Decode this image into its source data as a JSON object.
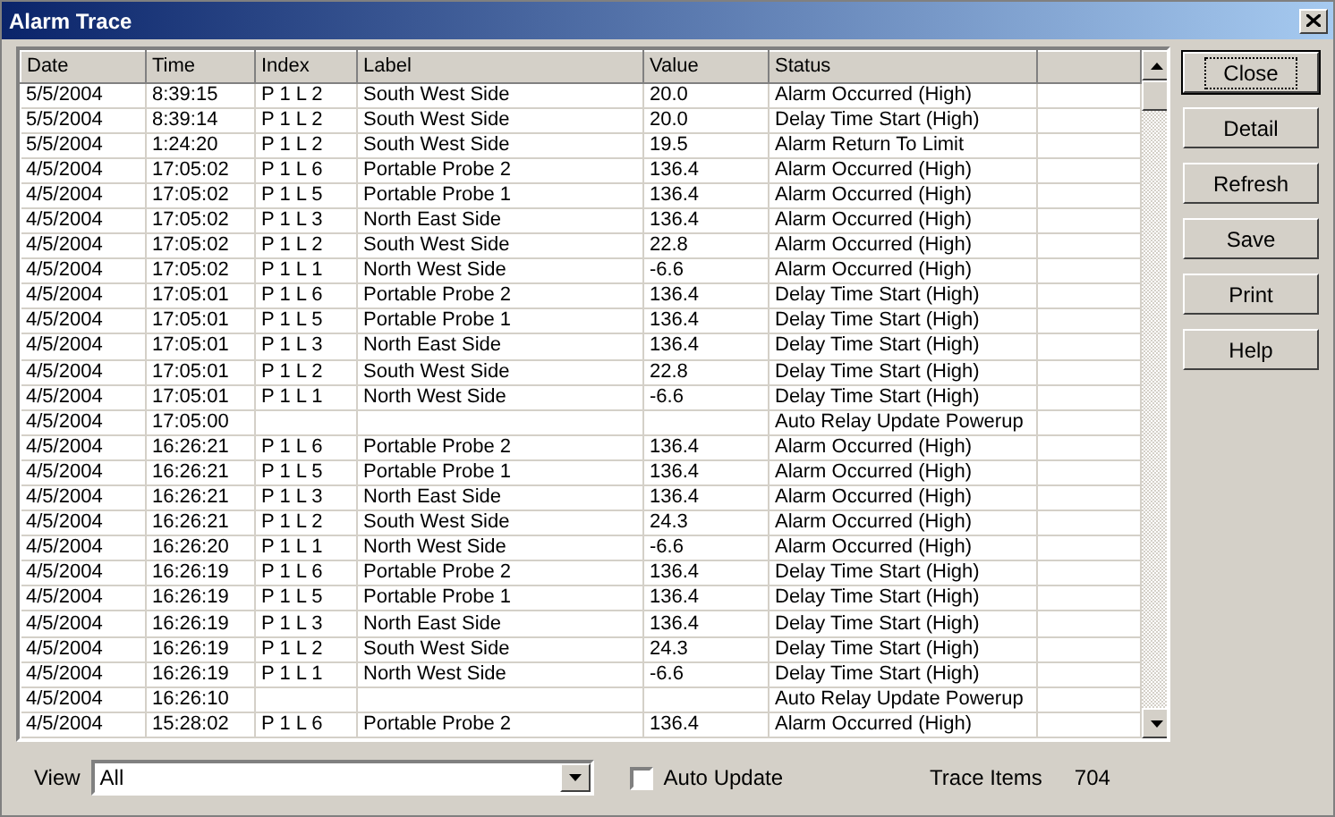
{
  "window": {
    "title": "Alarm Trace"
  },
  "table": {
    "columns": [
      "Date",
      "Time",
      "Index",
      "Label",
      "Value",
      "Status"
    ],
    "rows": [
      [
        "5/5/2004",
        "8:39:15",
        "P 1 L 2",
        "South West Side",
        "20.0",
        "Alarm Occurred (High)"
      ],
      [
        "5/5/2004",
        "8:39:14",
        "P 1 L 2",
        "South West Side",
        "20.0",
        "Delay Time Start (High)"
      ],
      [
        "5/5/2004",
        "1:24:20",
        "P 1 L 2",
        "South West Side",
        "19.5",
        "Alarm Return To Limit"
      ],
      [
        "4/5/2004",
        "17:05:02",
        "P 1 L 6",
        "Portable Probe 2",
        "136.4",
        "Alarm Occurred (High)"
      ],
      [
        "4/5/2004",
        "17:05:02",
        "P 1 L 5",
        "Portable Probe 1",
        "136.4",
        "Alarm Occurred (High)"
      ],
      [
        "4/5/2004",
        "17:05:02",
        "P 1 L 3",
        "North East Side",
        "136.4",
        "Alarm Occurred (High)"
      ],
      [
        "4/5/2004",
        "17:05:02",
        "P 1 L 2",
        "South West Side",
        "22.8",
        "Alarm Occurred (High)"
      ],
      [
        "4/5/2004",
        "17:05:02",
        "P 1 L 1",
        "North West Side",
        "-6.6",
        "Alarm Occurred (High)"
      ],
      [
        "4/5/2004",
        "17:05:01",
        "P 1 L 6",
        "Portable Probe 2",
        "136.4",
        "Delay Time Start (High)"
      ],
      [
        "4/5/2004",
        "17:05:01",
        "P 1 L 5",
        "Portable Probe 1",
        "136.4",
        "Delay Time Start (High)"
      ],
      [
        "4/5/2004",
        "17:05:01",
        "P 1 L 3",
        "North East Side",
        "136.4",
        "Delay Time Start (High)"
      ],
      [
        "4/5/2004",
        "17:05:01",
        "P 1 L 2",
        "South West Side",
        "22.8",
        "Delay Time Start (High)"
      ],
      [
        "4/5/2004",
        "17:05:01",
        "P 1 L 1",
        "North West Side",
        "-6.6",
        "Delay Time Start (High)"
      ],
      [
        "4/5/2004",
        "17:05:00",
        "",
        "",
        "",
        "Auto Relay Update Powerup"
      ],
      [
        "4/5/2004",
        "16:26:21",
        "P 1 L 6",
        "Portable Probe 2",
        "136.4",
        "Alarm Occurred (High)"
      ],
      [
        "4/5/2004",
        "16:26:21",
        "P 1 L 5",
        "Portable Probe 1",
        "136.4",
        "Alarm Occurred (High)"
      ],
      [
        "4/5/2004",
        "16:26:21",
        "P 1 L 3",
        "North East Side",
        "136.4",
        "Alarm Occurred (High)"
      ],
      [
        "4/5/2004",
        "16:26:21",
        "P 1 L 2",
        "South West Side",
        "24.3",
        "Alarm Occurred (High)"
      ],
      [
        "4/5/2004",
        "16:26:20",
        "P 1 L 1",
        "North West Side",
        "-6.6",
        "Alarm Occurred (High)"
      ],
      [
        "4/5/2004",
        "16:26:19",
        "P 1 L 6",
        "Portable Probe 2",
        "136.4",
        "Delay Time Start (High)"
      ],
      [
        "4/5/2004",
        "16:26:19",
        "P 1 L 5",
        "Portable Probe 1",
        "136.4",
        "Delay Time Start (High)"
      ],
      [
        "4/5/2004",
        "16:26:19",
        "P 1 L 3",
        "North East Side",
        "136.4",
        "Delay Time Start (High)"
      ],
      [
        "4/5/2004",
        "16:26:19",
        "P 1 L 2",
        "South West Side",
        "24.3",
        "Delay Time Start (High)"
      ],
      [
        "4/5/2004",
        "16:26:19",
        "P 1 L 1",
        "North West Side",
        "-6.6",
        "Delay Time Start (High)"
      ],
      [
        "4/5/2004",
        "16:26:10",
        "",
        "",
        "",
        "Auto Relay Update Powerup"
      ],
      [
        "4/5/2004",
        "15:28:02",
        "P 1 L 6",
        "Portable Probe 2",
        "136.4",
        "Alarm Occurred (High)"
      ]
    ]
  },
  "buttons": [
    {
      "label": "Close",
      "focused": true
    },
    {
      "label": "Detail",
      "focused": false
    },
    {
      "label": "Refresh",
      "focused": false
    },
    {
      "label": "Save",
      "focused": false
    },
    {
      "label": "Print",
      "focused": false
    },
    {
      "label": "Help",
      "focused": false
    }
  ],
  "view": {
    "label": "View",
    "value": "All"
  },
  "auto_update": {
    "label": "Auto Update",
    "checked": false
  },
  "trace_items": {
    "label": "Trace Items",
    "value": "704"
  }
}
